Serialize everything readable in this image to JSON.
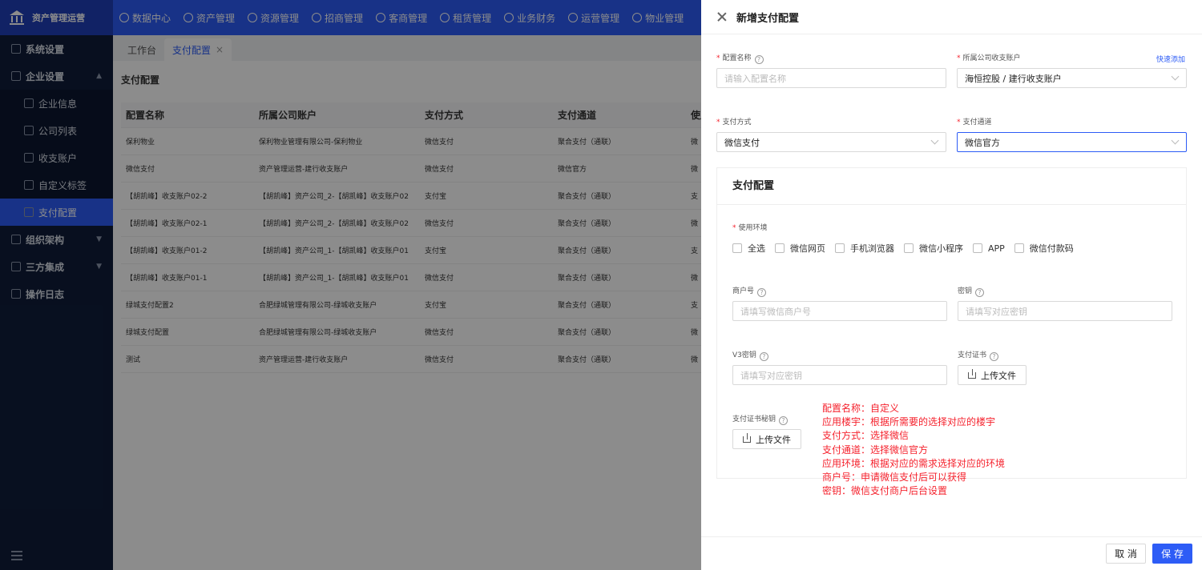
{
  "app": {
    "logo_text": "资产管理运营",
    "top_nav": [
      "数据中心",
      "资产管理",
      "资源管理",
      "招商管理",
      "客商管理",
      "租赁管理",
      "业务财务",
      "运营管理",
      "物业管理"
    ],
    "sidebar": [
      {
        "label": "系统设置",
        "type": "top"
      },
      {
        "label": "企业设置",
        "type": "top",
        "expanded": true
      },
      {
        "label": "企业信息",
        "type": "sub"
      },
      {
        "label": "公司列表",
        "type": "sub"
      },
      {
        "label": "收支账户",
        "type": "sub"
      },
      {
        "label": "自定义标签",
        "type": "sub"
      },
      {
        "label": "支付配置",
        "type": "sub",
        "active": true
      },
      {
        "label": "组织架构",
        "type": "top"
      },
      {
        "label": "三方集成",
        "type": "top"
      },
      {
        "label": "操作日志",
        "type": "top"
      }
    ],
    "tabs": [
      {
        "label": "工作台",
        "active": false
      },
      {
        "label": "支付配置",
        "active": true
      }
    ],
    "page_title": "支付配置",
    "table": {
      "headers": [
        "配置名称",
        "所属公司账户",
        "支付方式",
        "支付通道",
        "使用"
      ],
      "rows": [
        [
          "保利物业",
          "保利物业管理有限公司-保利物业",
          "微信支付",
          "聚合支付（通联）",
          "微"
        ],
        [
          "微信支付",
          "资产管理运营-建行收支账户",
          "微信支付",
          "微信官方",
          "微"
        ],
        [
          "【胡凯峰】收支账户02-2",
          "【胡凯峰】资产公司_2-【胡凯峰】收支账户02",
          "支付宝",
          "聚合支付（通联）",
          "支"
        ],
        [
          "【胡凯峰】收支账户02-1",
          "【胡凯峰】资产公司_2-【胡凯峰】收支账户02",
          "微信支付",
          "聚合支付（通联）",
          "微"
        ],
        [
          "【胡凯峰】收支账户01-2",
          "【胡凯峰】资产公司_1-【胡凯峰】收支账户01",
          "支付宝",
          "聚合支付（通联）",
          "支"
        ],
        [
          "【胡凯峰】收支账户01-1",
          "【胡凯峰】资产公司_1-【胡凯峰】收支账户01",
          "微信支付",
          "聚合支付（通联）",
          "微"
        ],
        [
          "绿城支付配置2",
          "合肥绿城管理有限公司-绿城收支账户",
          "支付宝",
          "聚合支付（通联）",
          "支"
        ],
        [
          "绿城支付配置",
          "合肥绿城管理有限公司-绿城收支账户",
          "微信支付",
          "聚合支付（通联）",
          "微"
        ],
        [
          "测试",
          "资产管理运营-建行收支账户",
          "微信支付",
          "聚合支付（通联）",
          "微"
        ]
      ]
    }
  },
  "drawer": {
    "title": "新增支付配置",
    "config_name": {
      "label": "配置名称",
      "placeholder": "请输入配置名称",
      "value": ""
    },
    "company_account": {
      "label": "所属公司收支账户",
      "value": "海恒控股 / 建行收支账户",
      "quick_add": "快速添加"
    },
    "pay_method": {
      "label": "支付方式",
      "value": "微信支付"
    },
    "pay_channel": {
      "label": "支付通道",
      "value": "微信官方"
    },
    "pay_config": {
      "title": "支付配置",
      "env_label": "使用环境",
      "env_options": [
        "全选",
        "微信网页",
        "手机浏览器",
        "微信小程序",
        "APP",
        "微信付款码"
      ],
      "merchant_no": {
        "label": "商户号",
        "placeholder": "请填写微信商户号"
      },
      "secret": {
        "label": "密钥",
        "placeholder": "请填写对应密钥"
      },
      "v3_secret": {
        "label": "V3密钥",
        "placeholder": "请填写对应密钥"
      },
      "cert": {
        "label": "支付证书",
        "button": "上传文件"
      },
      "cert_key": {
        "label": "支付证书秘钥",
        "button": "上传文件"
      },
      "notes": [
        "配置名称：自定义",
        "应用楼宇：根据所需要的选择对应的楼宇",
        "支付方式：选择微信",
        "支付通道：选择微信官方",
        "应用环境：根据对应的需求选择对应的环境",
        "商户号：申请微信支付后可以获得",
        "密钥：微信支付商户后台设置"
      ]
    },
    "cancel": "取 消",
    "save": "保 存"
  }
}
